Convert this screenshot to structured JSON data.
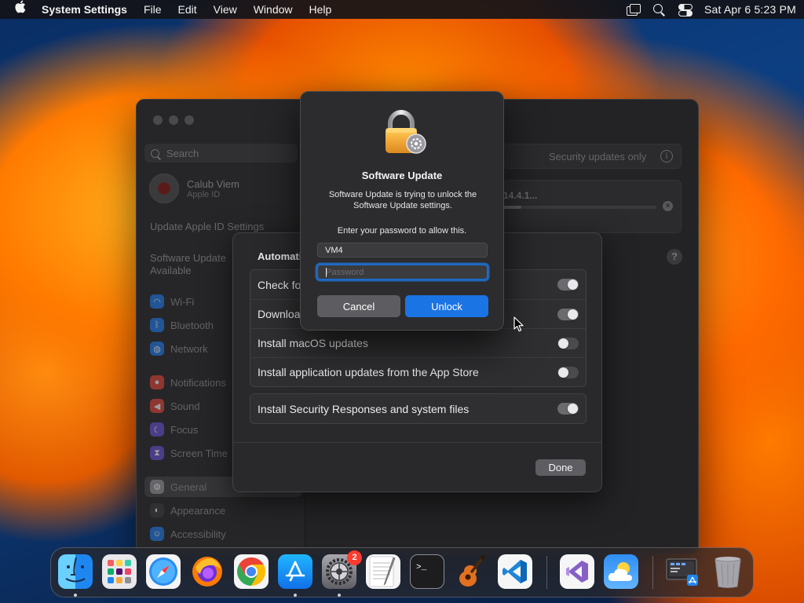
{
  "menubar": {
    "app_name": "System Settings",
    "menus": [
      "File",
      "Edit",
      "View",
      "Window",
      "Help"
    ],
    "clock": "Sat Apr 6  5:23 PM"
  },
  "settings_window": {
    "search_placeholder": "Search",
    "account": {
      "name": "Calub Viem",
      "subtitle": "Apple ID"
    },
    "notes": [
      "Update Apple ID Settings",
      "Software Update Available"
    ],
    "sidebar": [
      {
        "label": "Wi-Fi",
        "icon": "wifi-icon",
        "color": "#1e7cf0"
      },
      {
        "label": "Bluetooth",
        "icon": "bluetooth-icon",
        "color": "#1e7cf0"
      },
      {
        "label": "Network",
        "icon": "network-icon",
        "color": "#1e7cf0"
      },
      {
        "label": "Notifications",
        "icon": "bell-icon",
        "color": "#e8443a"
      },
      {
        "label": "Sound",
        "icon": "speaker-icon",
        "color": "#e8443a"
      },
      {
        "label": "Focus",
        "icon": "moon-icon",
        "color": "#6a50d8"
      },
      {
        "label": "Screen Time",
        "icon": "hourglass-icon",
        "color": "#6a50d8"
      },
      {
        "label": "General",
        "icon": "gear-icon",
        "color": "#8e8e93"
      },
      {
        "label": "Appearance",
        "icon": "appearance-icon",
        "color": "#3a3a3c"
      },
      {
        "label": "Accessibility",
        "icon": "accessibility-icon",
        "color": "#1e7cf0"
      }
    ],
    "security_option": "Security updates only",
    "update_version": "14.4.1..."
  },
  "sheet": {
    "title": "Automatic",
    "rows": [
      {
        "label": "Check for",
        "on": true
      },
      {
        "label": "Download",
        "on": true
      },
      {
        "label": "Install macOS updates",
        "on": false
      },
      {
        "label": "Install application updates from the App Store",
        "on": false
      }
    ],
    "security_row": {
      "label": "Install Security Responses and system files",
      "on": true
    },
    "done_label": "Done"
  },
  "dialog": {
    "title": "Software Update",
    "message": "Software Update is trying to unlock the Software Update settings.",
    "prompt": "Enter your password to allow this.",
    "username": "VM4",
    "password_placeholder": "Password",
    "cancel_label": "Cancel",
    "unlock_label": "Unlock"
  },
  "dock": {
    "apps": [
      {
        "name": "Finder",
        "icon": "finder-icon",
        "running": true
      },
      {
        "name": "Launchpad",
        "icon": "launchpad-icon",
        "running": false
      },
      {
        "name": "Safari",
        "icon": "safari-icon",
        "running": false
      },
      {
        "name": "Firefox",
        "icon": "firefox-icon",
        "running": false
      },
      {
        "name": "Chrome",
        "icon": "chrome-icon",
        "running": false
      },
      {
        "name": "App Store",
        "icon": "app-store-icon",
        "running": true
      },
      {
        "name": "System Settings",
        "icon": "system-settings-icon",
        "running": true,
        "badge": "2"
      },
      {
        "name": "TextEdit",
        "icon": "textedit-icon",
        "running": false
      },
      {
        "name": "Terminal",
        "icon": "terminal-icon",
        "running": false
      },
      {
        "name": "GarageBand",
        "icon": "garageband-icon",
        "running": false
      },
      {
        "name": "VS Code",
        "icon": "vscode-icon",
        "running": false
      },
      {
        "name": "Visual Studio",
        "icon": "visual-studio-icon",
        "running": false
      },
      {
        "name": "Weather",
        "icon": "weather-icon",
        "running": false
      },
      {
        "name": "Simulator",
        "icon": "simulator-icon",
        "running": false
      },
      {
        "name": "Trash",
        "icon": "trash-icon",
        "running": false
      }
    ]
  }
}
